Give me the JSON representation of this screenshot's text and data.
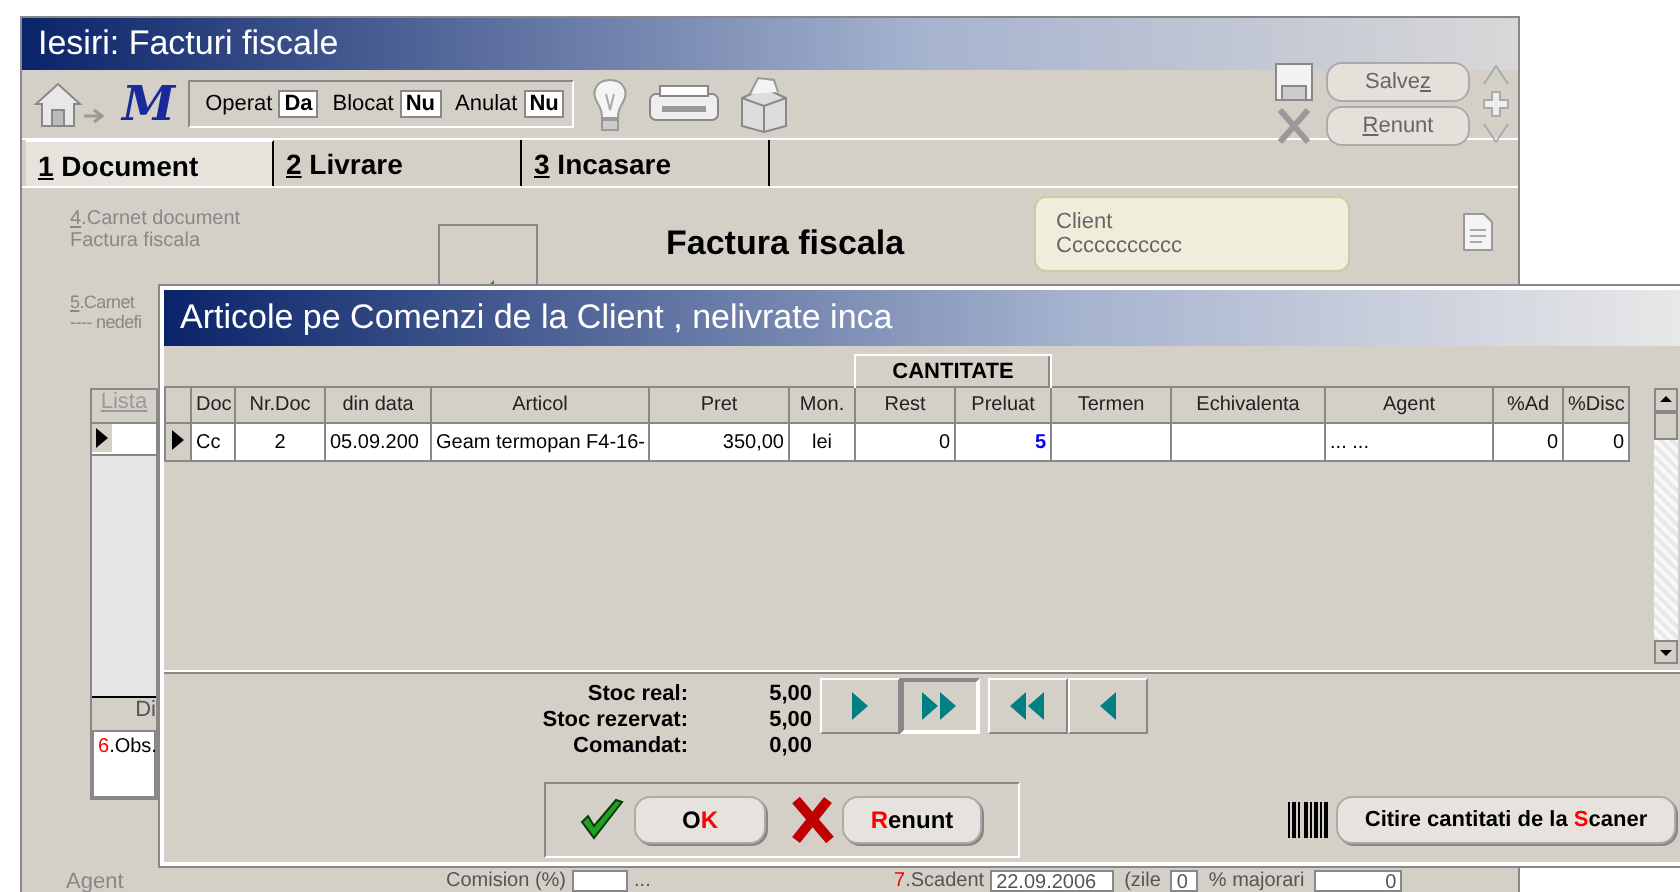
{
  "window": {
    "title": "Iesiri: Facturi fiscale"
  },
  "toolbar": {
    "logo": "M",
    "flags": [
      {
        "label": "Operat",
        "value": "Da"
      },
      {
        "label": "Blocat",
        "value": "Nu"
      },
      {
        "label": "Anulat",
        "value": "Nu"
      }
    ],
    "buttons": [
      {
        "parts": [
          {
            "text": "Salve",
            "hotkey": false
          },
          {
            "text": "z",
            "hotkey": true
          }
        ]
      },
      {
        "parts": [
          {
            "text": "R",
            "hotkey": true
          },
          {
            "text": "enunt",
            "hotkey": false
          }
        ]
      }
    ]
  },
  "tabs": [
    {
      "number": "1",
      "label": "Document",
      "selected": true
    },
    {
      "number": "2",
      "label": "Livrare",
      "selected": false
    },
    {
      "number": "3",
      "label": "Incasare",
      "selected": false
    }
  ],
  "document": {
    "carnet": {
      "number": "4",
      "label": ".Carnet document",
      "value": "Factura fiscala"
    },
    "heading": "Factura fiscala",
    "client": {
      "label": "Client",
      "value": "Ccccccccccc"
    },
    "carnet2": {
      "number": "5",
      "label": ".Carnet",
      "value": "---- nedefi"
    },
    "list": {
      "header": "Lista",
      "footer": "Di"
    },
    "obs": {
      "number": "6",
      "label": ".Obs."
    },
    "agent_label": "Agent",
    "commission": {
      "label": "Comision (%)",
      "value": "..."
    },
    "due": {
      "number": "7",
      "label": ".Scadent",
      "date": "22.09.2006",
      "days_label": "(zile",
      "days": "0",
      "surcharge_label": "% majorari",
      "surcharge": "0"
    }
  },
  "dialog": {
    "title": "Articole pe Comenzi de la Client , nelivrate inca",
    "group_header": "CANTITATE",
    "columns": [
      {
        "title": "Doc",
        "kind": "left"
      },
      {
        "title": "Nr.Doc",
        "kind": "center"
      },
      {
        "title": "din data",
        "kind": "left"
      },
      {
        "title": "Articol",
        "kind": "left"
      },
      {
        "title": "Pret",
        "kind": "right"
      },
      {
        "title": "Mon.",
        "kind": "center"
      },
      {
        "title": "Rest",
        "kind": "right"
      },
      {
        "title": "Preluat",
        "kind": "entry"
      },
      {
        "title": "Termen",
        "kind": "left"
      },
      {
        "title": "Echivalenta",
        "kind": "left"
      },
      {
        "title": "Agent",
        "kind": "left"
      },
      {
        "title": "%Ad",
        "kind": "right"
      },
      {
        "title": "%Disc",
        "kind": "right"
      }
    ],
    "rows": [
      {
        "current": true,
        "cells": [
          "Cc",
          "2",
          "05.09.200",
          "Geam termopan F4-16-",
          "350,00",
          "lei",
          "0",
          "5",
          null,
          null,
          "... ...",
          "0",
          "0"
        ]
      }
    ],
    "stock": [
      {
        "label": "Stoc real:",
        "value": "5,00"
      },
      {
        "label": "Stoc rezervat:",
        "value": "5,00"
      },
      {
        "label": "Comandat:",
        "value": "0,00"
      }
    ],
    "nav": [
      {
        "kind": "next",
        "pressed": false
      },
      {
        "kind": "last",
        "pressed": true
      },
      {
        "kind": "first",
        "pressed": false
      },
      {
        "kind": "previous",
        "pressed": false
      }
    ],
    "ok": {
      "parts": [
        {
          "text": "O",
          "hotkey": false
        },
        {
          "text": "K",
          "hotkey": true
        }
      ]
    },
    "cancel": {
      "parts": [
        {
          "text": "R",
          "hotkey": true
        },
        {
          "text": "enunt",
          "hotkey": false
        }
      ]
    },
    "scan": {
      "parts": [
        {
          "text": "Citire cantitati de la ",
          "hotkey": false
        },
        {
          "text": "S",
          "hotkey": true
        },
        {
          "text": "caner",
          "hotkey": false
        }
      ]
    }
  }
}
